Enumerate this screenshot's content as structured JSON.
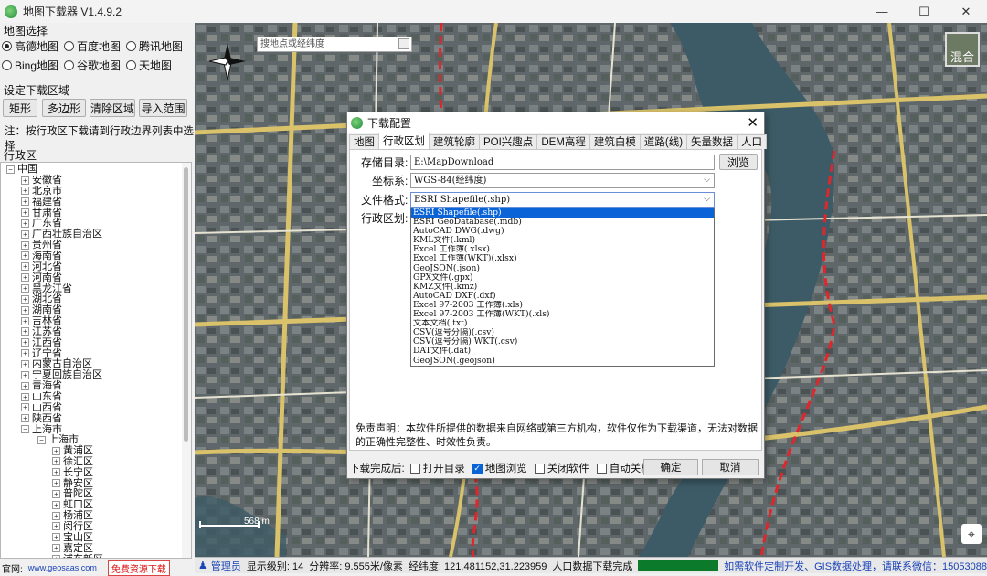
{
  "window": {
    "title": "地图下载器 V1.4.9.2",
    "controls": [
      "—",
      "☐",
      "✕"
    ]
  },
  "map_select": {
    "title": "地图选择",
    "options": [
      "高德地图",
      "百度地图",
      "腾讯地图",
      "Bing地图",
      "谷歌地图",
      "天地图"
    ],
    "selected": "高德地图"
  },
  "region_setting": {
    "title": "设定下载区域",
    "buttons": [
      "矩形",
      "多边形",
      "清除区域",
      "导入范围"
    ],
    "hint": "注：按行政区下载请到行政边界列表中选择"
  },
  "tree": {
    "title": "行政区",
    "root": "中国",
    "provinces": [
      "安徽省",
      "北京市",
      "福建省",
      "甘肃省",
      "广东省",
      "广西壮族自治区",
      "贵州省",
      "海南省",
      "河北省",
      "河南省",
      "黑龙江省",
      "湖北省",
      "湖南省",
      "吉林省",
      "江苏省",
      "江西省",
      "辽宁省",
      "内蒙古自治区",
      "宁夏回族自治区",
      "青海省",
      "山东省",
      "山西省",
      "陕西省",
      "上海市"
    ],
    "sub_city": "上海市",
    "districts": [
      "黄浦区",
      "徐汇区",
      "长宁区",
      "静安区",
      "普陀区",
      "虹口区",
      "杨浦区",
      "闵行区",
      "宝山区",
      "嘉定区",
      "浦东新区"
    ]
  },
  "footer": {
    "official_label": "官网:",
    "url": "www.geosaas.com",
    "free_download": "免费资源下载"
  },
  "map": {
    "search_placeholder": "搜地点或经纬度",
    "scale_label": "568 m",
    "layer_label": "混合"
  },
  "status": {
    "user": "管理员",
    "zoom_text": "显示级别: 14",
    "resolution_text": "分辨率: 9.555米/像素",
    "coords_text": "经纬度: 121.481152,31.223959",
    "download_status": "人口数据下载完成",
    "promo": "如需软件定制开发、GIS数据处理，请联系微信：15053088"
  },
  "dialog": {
    "title": "下载配置",
    "tabs": [
      "地图",
      "行政区划",
      "建筑轮廓",
      "POI兴趣点",
      "DEM高程",
      "建筑白模",
      "道路(线)",
      "矢量数据",
      "人口"
    ],
    "active_tab": "行政区划",
    "storage_label": "存储目录:",
    "storage_value": "E:\\MapDownload",
    "browse_label": "浏览",
    "crs_label": "坐标系:",
    "crs_value": "WGS-84(经纬度)",
    "format_label": "文件格式:",
    "format_value": "ESRI Shapefile(.shp)",
    "region_label": "行政区划:",
    "format_options": [
      "ESRI Shapefile(.shp)",
      "ESRI GeoDatabase(.mdb)",
      "AutoCAD DWG(.dwg)",
      "KML文件(.kml)",
      "Excel 工作簿(.xlsx)",
      "Excel 工作簿(WKT)(.xlsx)",
      "GeoJSON(.json)",
      "GPX文件(.gpx)",
      "KMZ文件(.kmz)",
      "AutoCAD DXF(.dxf)",
      "Excel 97-2003 工作簿(.xls)",
      "Excel 97-2003 工作簿(WKT)(.xls)",
      "文本文档(.txt)",
      "CSV(逗号分隔)(.csv)",
      "CSV(逗号分隔) WKT(.csv)",
      "DAT文件(.dat)",
      "GeoJSON(.geojson)"
    ],
    "disclaimer": "免责声明：本软件所提供的数据来自网络或第三方机构，软件仅作为下载渠道，无法对数据的正确性完整性、时效性负责。",
    "after_label": "下载完成后:",
    "after_options": [
      {
        "label": "打开目录",
        "checked": false
      },
      {
        "label": "地图浏览",
        "checked": true
      },
      {
        "label": "关闭软件",
        "checked": false
      },
      {
        "label": "自动关机",
        "checked": false
      }
    ],
    "ok_label": "确定",
    "cancel_label": "取消"
  },
  "colors": {
    "accent": "#0a64d8",
    "progress": "#0b7a2a",
    "link": "#1a43b8",
    "boundary": "#e0262a"
  }
}
